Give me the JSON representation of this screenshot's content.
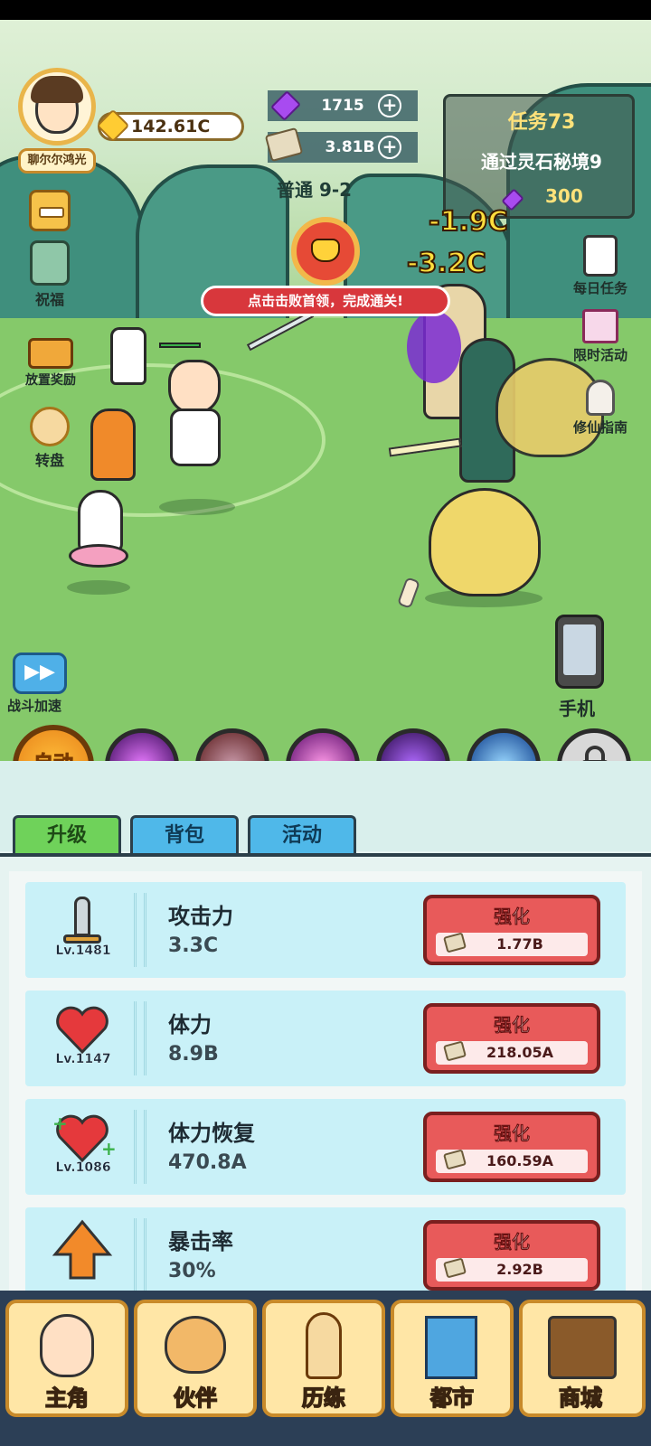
{
  "player": {
    "name": "聊尔尔鸿光",
    "gold": "142.61C"
  },
  "resources": {
    "gems": "1715",
    "cash": "3.81B",
    "stage": "普通 9-2"
  },
  "task": {
    "title": "任务73",
    "desc": "通过灵石秘境9",
    "reward": "300"
  },
  "damage": {
    "d1": "-1.9C",
    "d2": "-3.2C"
  },
  "boss": {
    "banner": "点击击败首领，完成通关!"
  },
  "left_menu": {
    "blessing": "祝福",
    "idle_reward": "放置奖励",
    "wheel": "转盘",
    "speed": "战斗加速"
  },
  "right_menu": {
    "daily": "每日任务",
    "limited": "限时活动",
    "guide": "修仙指南",
    "phone": "手机"
  },
  "skills": {
    "auto": "自动"
  },
  "tabs": [
    {
      "label": "升级"
    },
    {
      "label": "背包"
    },
    {
      "label": "活动"
    }
  ],
  "upgrades": [
    {
      "name": "攻击力",
      "value": "3.3C",
      "level": "Lv.1481",
      "btn": "强化",
      "cost": "1.77B"
    },
    {
      "name": "体力",
      "value": "8.9B",
      "level": "Lv.1147",
      "btn": "强化",
      "cost": "218.05A"
    },
    {
      "name": "体力恢复",
      "value": "470.8A",
      "level": "Lv.1086",
      "btn": "强化",
      "cost": "160.59A"
    },
    {
      "name": "暴击率",
      "value": "30%",
      "level": "",
      "btn": "强化",
      "cost": "2.92B"
    }
  ],
  "nav": [
    {
      "label": "主角"
    },
    {
      "label": "伙伴"
    },
    {
      "label": "历练"
    },
    {
      "label": "都市"
    },
    {
      "label": "商城"
    }
  ],
  "colors": {
    "upgrade_button": "#e85a5a",
    "tab_active": "#6fd25a",
    "tab_inactive": "#4fb8e9",
    "nav_bg": "#2c3f56"
  }
}
